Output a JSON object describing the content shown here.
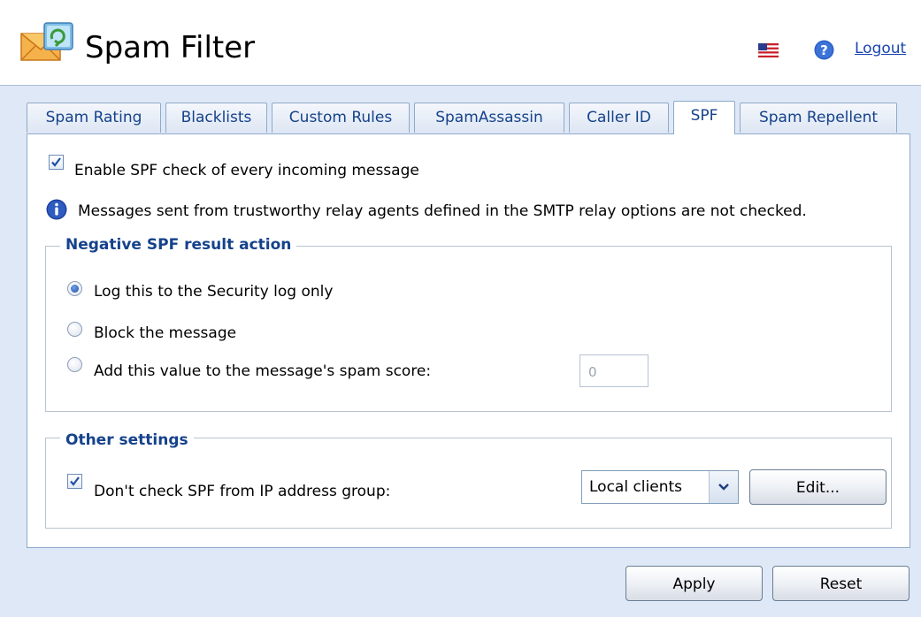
{
  "header": {
    "title": "Spam Filter",
    "logout_label": "Logout",
    "app_icon": "spam-filter-mail-icon",
    "language_icon": "us-flag-icon",
    "help_icon": "help-icon"
  },
  "tabs": [
    {
      "label": "Spam Rating",
      "active": false
    },
    {
      "label": "Blacklists",
      "active": false
    },
    {
      "label": "Custom Rules",
      "active": false
    },
    {
      "label": "SpamAssassin",
      "active": false
    },
    {
      "label": "Caller ID",
      "active": false
    },
    {
      "label": "SPF",
      "active": true
    },
    {
      "label": "Spam Repellent",
      "active": false
    }
  ],
  "spf": {
    "enable_label": "Enable SPF check of every incoming message",
    "enable_checked": true,
    "info_text": "Messages sent from trustworthy relay agents defined in the SMTP relay options are not checked.",
    "negative_action": {
      "legend": "Negative SPF result action",
      "options": [
        {
          "label": "Log this to the Security log only",
          "selected": true
        },
        {
          "label": "Block the message",
          "selected": false
        },
        {
          "label": "Add this value to the message's spam score:",
          "selected": false
        }
      ],
      "score_value": "0"
    },
    "other_settings": {
      "legend": "Other settings",
      "ip_group_label": "Don't check SPF from IP address group:",
      "ip_group_checked": true,
      "ip_group_selected": "Local clients",
      "edit_label": "Edit..."
    }
  },
  "footer": {
    "apply_label": "Apply",
    "reset_label": "Reset"
  },
  "colors": {
    "background": "#dfe8f6",
    "tab_text": "#15428b",
    "legend_text": "#15428b",
    "link": "#1a44b0"
  }
}
